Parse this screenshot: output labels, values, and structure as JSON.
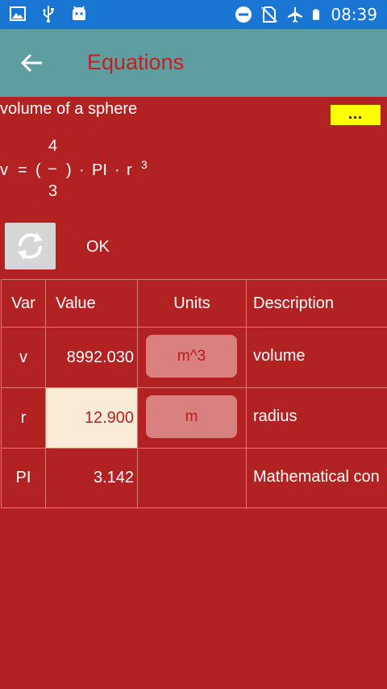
{
  "status_bar": {
    "time": "08:39",
    "icons_left": [
      "image-icon",
      "usb-icon",
      "android-icon"
    ],
    "icons_right": [
      "do-not-disturb-icon",
      "no-sim-icon",
      "airplane-mode-icon",
      "battery-icon"
    ]
  },
  "header": {
    "title": "Equations",
    "back_icon": "arrow-back-icon"
  },
  "equation": {
    "name": "volume of a sphere",
    "more_label": "...",
    "formula": {
      "lhs": "v",
      "equals": "=",
      "open_paren": "(",
      "numerator": "4",
      "fraction_bar": "−",
      "denominator": "3",
      "close_paren": ")",
      "dot1": "·",
      "pi": "PI",
      "dot2": "·",
      "r": "r",
      "exponent": "3"
    }
  },
  "actions": {
    "refresh_icon": "refresh-icon",
    "ok_label": "OK"
  },
  "table": {
    "headers": {
      "var": "Var",
      "value": "Value",
      "units": "Units",
      "description": "Description"
    },
    "rows": [
      {
        "var": "v",
        "value": "8992.030",
        "units": "m^3",
        "description": "volume"
      },
      {
        "var": "r",
        "value": "12.900",
        "units": "m",
        "description": "radius"
      },
      {
        "var": "PI",
        "value": "3.142",
        "units": "",
        "description": "Mathematical con"
      }
    ]
  },
  "colors": {
    "status_bar": "#1976d2",
    "app_bar": "#5f9ea0",
    "background": "#b22222",
    "title": "#c41e1e",
    "more_button": "#ffff00",
    "input_cell": "#faebd7",
    "unit_button": "#d98080"
  }
}
